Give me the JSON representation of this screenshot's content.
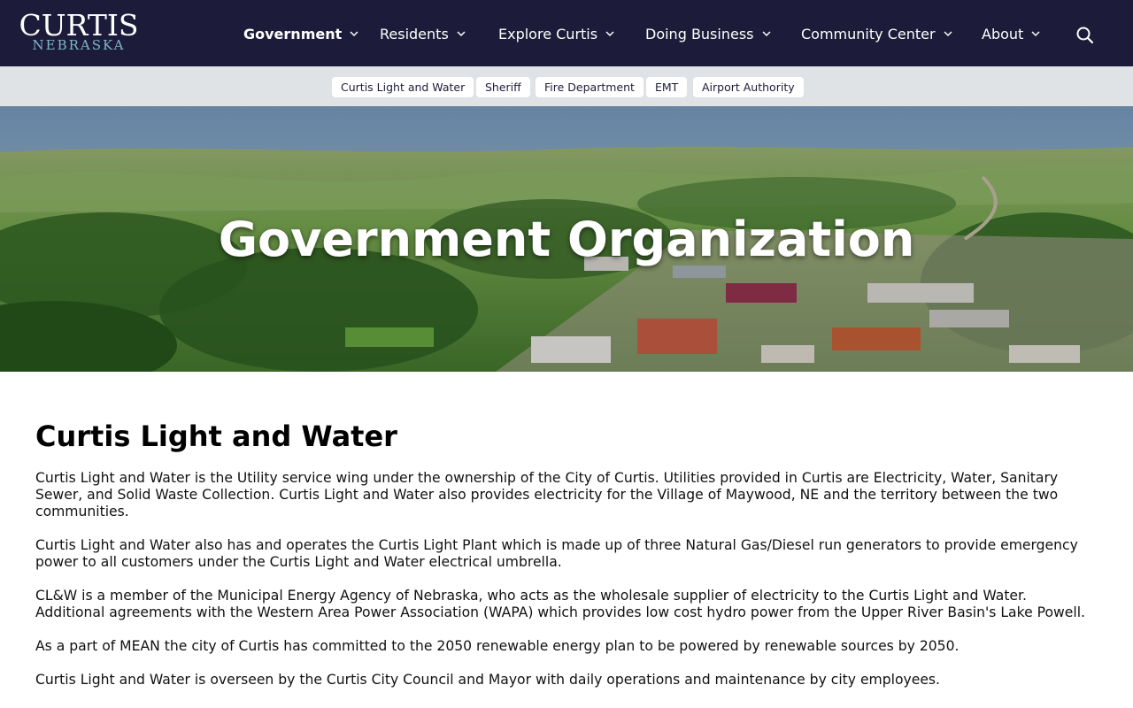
{
  "header": {
    "logo_main": "CURTIS",
    "logo_sub": "NEBRASKA",
    "nav": [
      {
        "label": "Government",
        "active": true
      },
      {
        "label": "Residents"
      },
      {
        "label": "Explore Curtis"
      },
      {
        "label": "Doing Business"
      },
      {
        "label": "Community Center"
      },
      {
        "label": "About"
      }
    ],
    "search_icon": "search-icon"
  },
  "subnav": {
    "items": [
      "Curtis Light and Water",
      "Sheriff",
      "Fire Department",
      "EMT",
      "Airport Authority"
    ]
  },
  "hero": {
    "title": "Government Organization"
  },
  "main": {
    "heading": "Curtis Light and Water",
    "paragraphs": [
      "Curtis Light and Water is the Utility service wing under the ownership of the City of Curtis.  Utilities provided in Curtis are Electricity, Water, Sanitary Sewer, and Solid Waste Collection.  Curtis Light and Water also provides electricity for the Village of Maywood, NE and the territory between the two communities.",
      "Curtis Light and Water also has and operates the Curtis Light Plant which is made up of three Natural Gas/Diesel run generators to provide emergency power to all customers under the Curtis Light and Water electrical umbrella.",
      "CL&W is a member of the Municipal Energy Agency of Nebraska, who acts as the wholesale supplier of electricity to the Curtis Light and Water. Additional agreements with the Western Area Power Association (WAPA) which provides low cost hydro power from the Upper River Basin's Lake Powell.",
      "As a part of MEAN the city of Curtis has committed to the 2050 renewable energy plan to be powered by renewable sources by 2050.",
      "Curtis Light and Water is overseen by the Curtis City Council and Mayor with daily operations and maintenance by city employees."
    ]
  },
  "colors": {
    "header_bg": "#1c1c3a",
    "subnav_bg": "#dfe3e6",
    "logo_accent": "#7fb7c7"
  }
}
